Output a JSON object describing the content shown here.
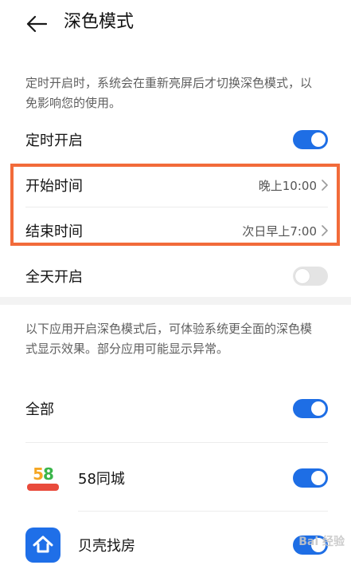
{
  "header": {
    "title": "深色模式"
  },
  "schedule_note": "定时开启时，系统会在重新亮屏后才切换深色模式，以免影响您的使用。",
  "schedule_toggle": {
    "label": "定时开启",
    "state": "on"
  },
  "start_time": {
    "label": "开始时间",
    "value": "晚上10:00"
  },
  "end_time": {
    "label": "结束时间",
    "value": "次日早上7:00"
  },
  "all_day_toggle": {
    "label": "全天开启",
    "state": "off"
  },
  "apps_note": "以下应用开启深色模式后，可体验系统更全面的深色模式显示效果。部分应用可能显示异常。",
  "apps": [
    {
      "name": "全部",
      "state": "on",
      "icon": "none"
    },
    {
      "name": "58同城",
      "state": "on",
      "icon": "58-logo-icon"
    },
    {
      "name": "贝壳找房",
      "state": "on",
      "icon": "beike-logo-icon"
    }
  ],
  "colors": {
    "accent": "#1e6ee5",
    "toggle_off": "#e4e4e4",
    "highlight": "#f26b3a"
  },
  "watermark": "Bai 经验"
}
